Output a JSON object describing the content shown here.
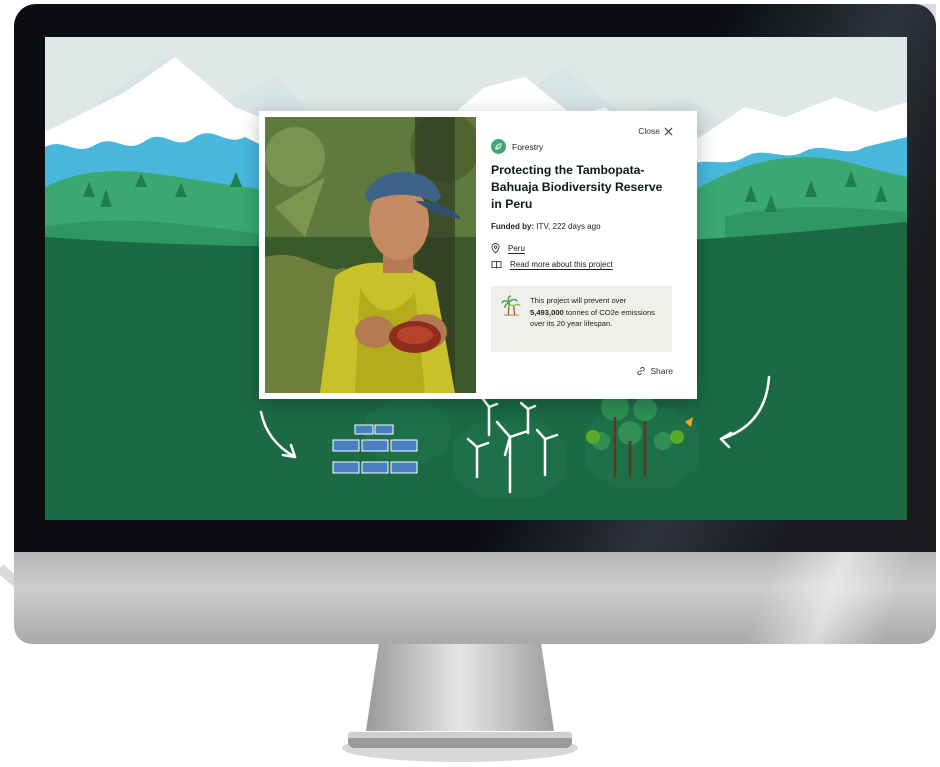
{
  "modal": {
    "close_label": "Close",
    "category": "Forestry",
    "title": "Protecting the Tambopata-Bahuaja Biodiversity Reserve in Peru",
    "funded_label": "Funded by:",
    "funded_value": " ITV, 222 days ago",
    "location": "Peru",
    "read_more": "Read more about this project",
    "impact_prefix": "This project will prevent over ",
    "impact_amount": "5,493,000",
    "impact_suffix": " tonnes of CO2e emissions over its 20 year lifespan.",
    "share_label": "Share"
  },
  "icons": {
    "close": "close-icon",
    "category": "leaf-icon",
    "location": "map-pin-icon",
    "read_more": "book-icon",
    "impact": "palm-trees-icon",
    "share": "link-icon"
  },
  "colors": {
    "screen_green": "#1b6a44",
    "mountain_blue": "#48b7dc",
    "hill_green": "#3aa870",
    "category_green": "#3fa772",
    "impact_bg": "#f1efec",
    "pencil_orange": "#f5a623"
  },
  "scene_tiles": [
    "solar-panels-tile",
    "wind-turbines-tile",
    "forest-tile"
  ]
}
